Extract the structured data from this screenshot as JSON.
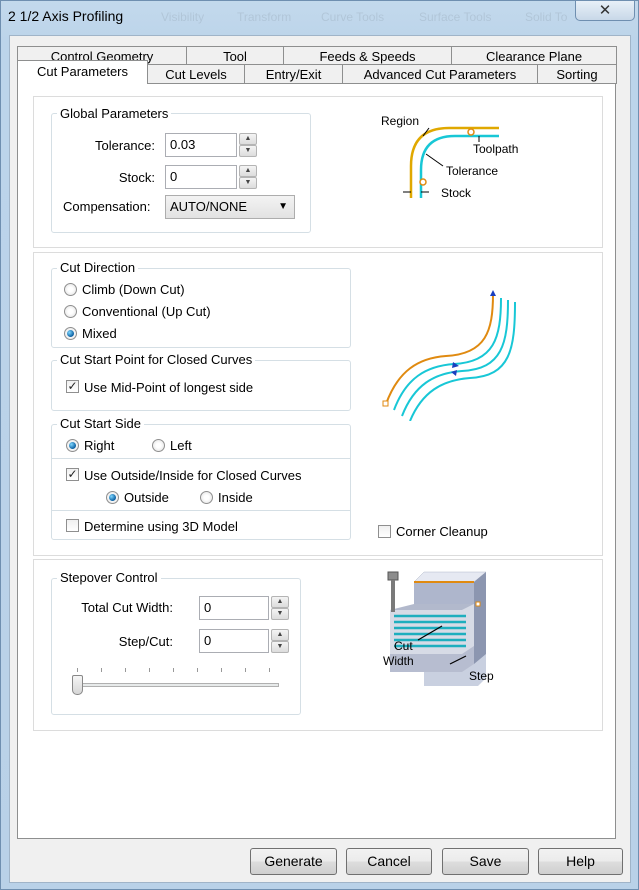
{
  "window": {
    "title": "2 1/2 Axis Profiling",
    "close_glyph": "✕",
    "ghost_toolbar": [
      "Visibility",
      "Transform",
      "Curve Tools",
      "Surface Tools",
      "Solid To"
    ]
  },
  "tabs": {
    "row1": [
      "Control Geometry",
      "Tool",
      "Feeds & Speeds",
      "Clearance Plane"
    ],
    "row2": [
      "Cut Parameters",
      "Cut Levels",
      "Entry/Exit",
      "Advanced Cut Parameters",
      "Sorting"
    ],
    "active": "Cut Parameters"
  },
  "global_parameters": {
    "title": "Global Parameters",
    "tolerance_label": "Tolerance:",
    "tolerance_value": "0.03",
    "stock_label": "Stock:",
    "stock_value": "0",
    "compensation_label": "Compensation:",
    "compensation_value": "AUTO/NONE",
    "figure": {
      "region": "Region",
      "toolpath": "Toolpath",
      "tolerance": "Tolerance",
      "stock": "Stock"
    }
  },
  "cut_direction": {
    "title": "Cut Direction",
    "options": [
      "Climb (Down Cut)",
      "Conventional (Up Cut)",
      "Mixed"
    ],
    "selected": "Mixed"
  },
  "cut_start_point": {
    "title": "Cut Start Point for Closed Curves",
    "midpoint_label": "Use Mid-Point of longest side",
    "midpoint_checked": true
  },
  "cut_start_side": {
    "title": "Cut Start Side",
    "right_label": "Right",
    "left_label": "Left",
    "selected": "Right",
    "use_outside_inside_label": "Use Outside/Inside for Closed Curves",
    "use_outside_inside_checked": true,
    "outside_label": "Outside",
    "inside_label": "Inside",
    "inside_outside_selected": "Outside",
    "determine_3d_label": "Determine using 3D Model",
    "determine_3d_checked": false
  },
  "corner_cleanup": {
    "label": "Corner Cleanup",
    "checked": false
  },
  "stepover_control": {
    "title": "Stepover Control",
    "total_cut_width_label": "Total Cut Width:",
    "total_cut_width_value": "0",
    "step_cut_label": "Step/Cut:",
    "step_cut_value": "0",
    "slider_fraction": 0,
    "figure": {
      "cut": "Cut",
      "width": "Width",
      "step": "Step"
    }
  },
  "buttons": {
    "generate": "Generate",
    "cancel": "Cancel",
    "save": "Save",
    "help": "Help"
  },
  "colors": {
    "toolpath_orange": "#e08a10",
    "toolpath_cyan": "#18c7d6",
    "stock_gold": "#e0a800",
    "arrow_blue": "#1a3fbf",
    "accent_teal": "#1eaebe"
  }
}
